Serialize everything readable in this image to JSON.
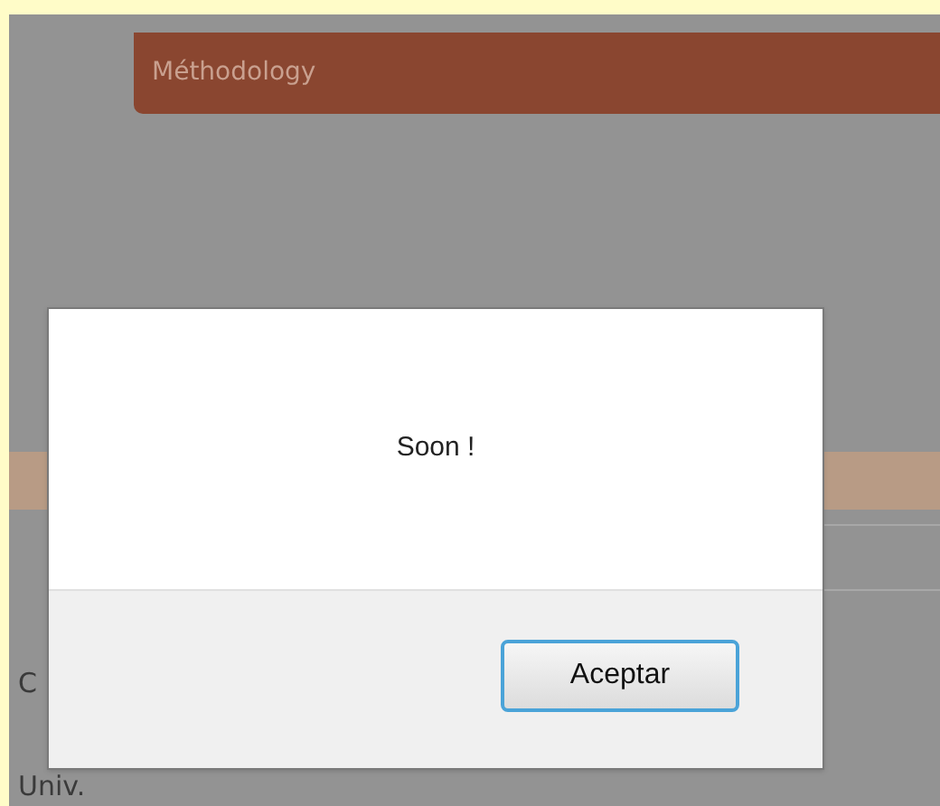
{
  "page": {
    "menu_bar": {
      "label": "Méthodology"
    },
    "texts": [
      "C",
      "Univ."
    ]
  },
  "dialog": {
    "message": "Soon !",
    "buttons": [
      {
        "label": "Aceptar",
        "focused": true
      }
    ]
  }
}
